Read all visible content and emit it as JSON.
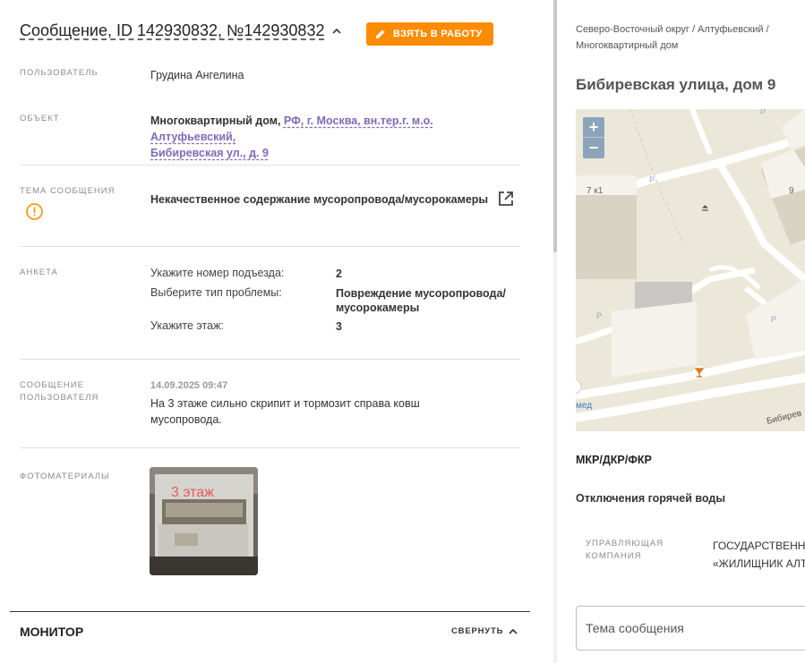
{
  "message": {
    "title": "Сообщение, ID 142930832, №142930832",
    "take_button": "ВЗЯТЬ В РАБОТУ"
  },
  "user": {
    "label": "ПОЛЬЗОВАТЕЛЬ",
    "value": "Грудина Ангелина"
  },
  "object": {
    "label": "ОБЪЕКТ",
    "type": "Многоквартирный дом,",
    "address_line1": "РФ, г. Москва, вн.тер.г. м.о. Алтуфьевский,",
    "address_line2": "Бибиревская ул., д. 9"
  },
  "topic": {
    "label": "ТЕМА СООБЩЕНИЯ",
    "value": "Некачественное содержание мусоропровода/мусорокамеры"
  },
  "survey": {
    "label": "АНКЕТА",
    "items": [
      {
        "question": "Укажите номер подъезда:",
        "answer": "2"
      },
      {
        "question": "Выберите тип проблемы:",
        "answer": "Повреждение мусоропровода/",
        "answer2": "мусорокамеры"
      },
      {
        "question": "Укажите этаж:",
        "answer": "3"
      }
    ]
  },
  "user_message": {
    "label_line1": "СООБЩЕНИЕ",
    "label_line2": "ПОЛЬЗОВАТЕЛЯ",
    "date": "14.09.2025 09:47",
    "text_line1": "На 3 этаже сильно скрипит и тормозит справа ковш",
    "text_line2": "мусопровода."
  },
  "photos": {
    "label": "ФОТОМАТЕРИАЛЫ",
    "photo_caption": "3 этаж"
  },
  "monitor": {
    "title": "МОНИТОР",
    "collapse": "СВЕРНУТЬ"
  },
  "right": {
    "breadcrumb_line1": "Северо-Восточный округ / Алтуфьевский /",
    "breadcrumb_line2": "Многоквартирный дом",
    "address": "Бибиревская улица, дом 9",
    "map": {
      "zoom_in": "+",
      "zoom_out": "−",
      "label_7k1": "7 к1",
      "label_9": "9",
      "label_med": "мед",
      "street": "Бибирев",
      "parking": "P"
    },
    "section1": "МКР/ДКР/ФКР",
    "section2": "Отключения горячей воды",
    "company_label_line1": "УПРАВЛЯЮЩАЯ",
    "company_label_line2": "КОМПАНИЯ",
    "company_line1": "ГОСУДАРСТВЕННОЕ",
    "company_line2": "«ЖИЛИЩНИК АЛТ",
    "subject_placeholder": "Тема сообщения"
  },
  "colors": {
    "accent": "#ff8c00",
    "link": "#7f6ab5",
    "warning": "#f39a1e"
  }
}
